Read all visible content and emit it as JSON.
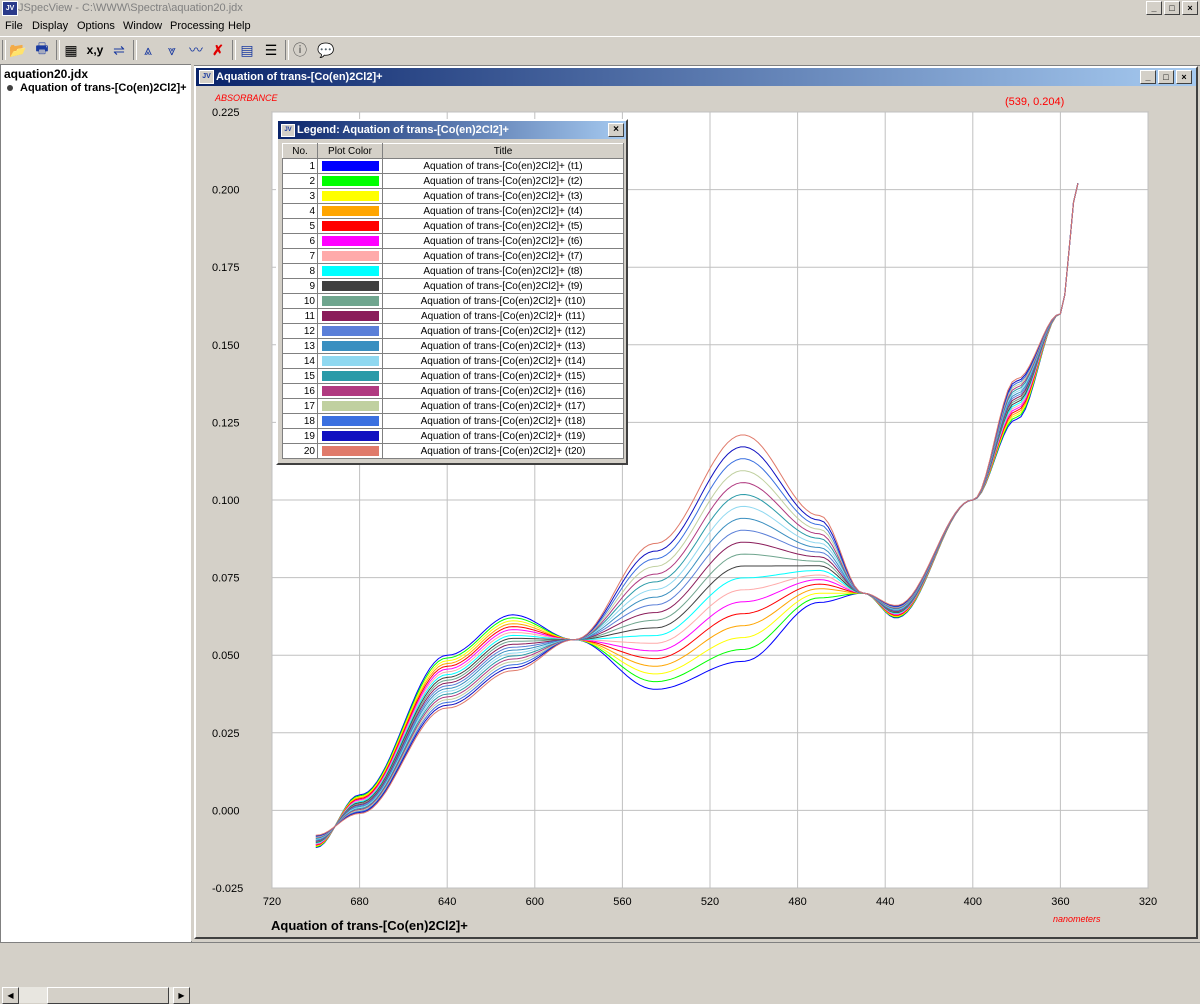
{
  "app": {
    "title": "JSpecView - C:\\WWW\\Spectra\\aquation20.jdx",
    "icon_label": "JV",
    "window_buttons": [
      "_",
      "□",
      "×"
    ]
  },
  "menu": [
    "File",
    "Display",
    "Options",
    "Window",
    "Processing",
    "Help"
  ],
  "toolbar": {
    "buttons": [
      {
        "name": "open-icon",
        "glyph": "📂"
      },
      {
        "name": "print-icon",
        "glyph": "🖶"
      },
      {
        "name": "grid-icon",
        "glyph": "▦"
      },
      {
        "name": "coordinates-button",
        "glyph": "x,y"
      },
      {
        "name": "reverse-plot-icon",
        "glyph": "⇌"
      },
      {
        "name": "overlay-spectra-icon",
        "glyph": "⩓"
      },
      {
        "name": "split-spectra-icon",
        "glyph": "⩔"
      },
      {
        "name": "overlay-key-icon",
        "glyph": "〰"
      },
      {
        "name": "close-spectrum-icon",
        "glyph": "✗"
      },
      {
        "name": "source-view-icon",
        "glyph": "▤"
      },
      {
        "name": "legend-list-icon",
        "glyph": "☰"
      },
      {
        "name": "about-icon",
        "glyph": "ⓘ"
      },
      {
        "name": "help-icon",
        "glyph": "💬"
      }
    ]
  },
  "tree": {
    "file": "aquation20.jdx",
    "item": "Aquation of trans-[Co(en)2Cl2]+"
  },
  "child_window": {
    "title": "Aquation of trans-[Co(en)2Cl2]+"
  },
  "plot": {
    "ylabel": "ABSORBANCE",
    "xlabel": "nanometers",
    "title": "Aquation of trans-[Co(en)2Cl2]+",
    "coord_readout": "(539, 0.204)",
    "y_ticks": [
      "0.225",
      "0.200",
      "0.175",
      "0.150",
      "0.125",
      "0.100",
      "0.075",
      "0.050",
      "0.025",
      "0.000",
      "-0.025"
    ],
    "x_ticks": [
      "720",
      "680",
      "640",
      "600",
      "560",
      "520",
      "480",
      "440",
      "400",
      "360",
      "320"
    ],
    "xlim": [
      720,
      320
    ],
    "ylim": [
      -0.025,
      0.225
    ]
  },
  "chart_data": {
    "type": "line",
    "x_range": [
      700,
      352
    ],
    "xlim": [
      720,
      320
    ],
    "ylim": [
      -0.025,
      0.225
    ],
    "grid": true,
    "xlabel": "nanometers",
    "ylabel": "ABSORBANCE",
    "series_t1": {
      "x": [
        700,
        680,
        640,
        610,
        582,
        545,
        505,
        470,
        450,
        435,
        400,
        380,
        360,
        352
      ],
      "y": [
        -0.012,
        0.005,
        0.05,
        0.063,
        0.055,
        0.039,
        0.048,
        0.067,
        0.07,
        0.062,
        0.1,
        0.126,
        0.16,
        0.202
      ]
    },
    "series_t20": {
      "x": [
        700,
        680,
        640,
        610,
        582,
        545,
        505,
        470,
        450,
        435,
        400,
        380,
        360,
        352
      ],
      "y": [
        -0.008,
        -0.001,
        0.033,
        0.045,
        0.055,
        0.086,
        0.121,
        0.095,
        0.07,
        0.066,
        0.1,
        0.139,
        0.16,
        0.202
      ]
    }
  },
  "legend": {
    "title": "Legend: Aquation of trans-[Co(en)2Cl2]+",
    "close_glyph": "×",
    "headers": [
      "No.",
      "Plot Color",
      "Title"
    ],
    "rows": [
      {
        "no": "1",
        "color": "#0000ff",
        "title": "Aquation of trans-[Co(en)2Cl2]+ (t1)"
      },
      {
        "no": "2",
        "color": "#00ff00",
        "title": "Aquation of trans-[Co(en)2Cl2]+ (t2)"
      },
      {
        "no": "3",
        "color": "#ffff00",
        "title": "Aquation of trans-[Co(en)2Cl2]+ (t3)"
      },
      {
        "no": "4",
        "color": "#ffa500",
        "title": "Aquation of trans-[Co(en)2Cl2]+ (t4)"
      },
      {
        "no": "5",
        "color": "#ff0000",
        "title": "Aquation of trans-[Co(en)2Cl2]+ (t5)"
      },
      {
        "no": "6",
        "color": "#ff00ff",
        "title": "Aquation of trans-[Co(en)2Cl2]+ (t6)"
      },
      {
        "no": "7",
        "color": "#ffaaaa",
        "title": "Aquation of trans-[Co(en)2Cl2]+ (t7)"
      },
      {
        "no": "8",
        "color": "#00ffff",
        "title": "Aquation of trans-[Co(en)2Cl2]+ (t8)"
      },
      {
        "no": "9",
        "color": "#404040",
        "title": "Aquation of trans-[Co(en)2Cl2]+ (t9)"
      },
      {
        "no": "10",
        "color": "#6fa58e",
        "title": "Aquation of trans-[Co(en)2Cl2]+ (t10)"
      },
      {
        "no": "11",
        "color": "#8a1c5a",
        "title": "Aquation of trans-[Co(en)2Cl2]+ (t11)"
      },
      {
        "no": "12",
        "color": "#5a7fd8",
        "title": "Aquation of trans-[Co(en)2Cl2]+ (t12)"
      },
      {
        "no": "13",
        "color": "#3a8fc0",
        "title": "Aquation of trans-[Co(en)2Cl2]+ (t13)"
      },
      {
        "no": "14",
        "color": "#8fd8f0",
        "title": "Aquation of trans-[Co(en)2Cl2]+ (t14)"
      },
      {
        "no": "15",
        "color": "#2a9aa8",
        "title": "Aquation of trans-[Co(en)2Cl2]+ (t15)"
      },
      {
        "no": "16",
        "color": "#b03a80",
        "title": "Aquation of trans-[Co(en)2Cl2]+ (t16)"
      },
      {
        "no": "17",
        "color": "#c0d0a0",
        "title": "Aquation of trans-[Co(en)2Cl2]+ (t17)"
      },
      {
        "no": "18",
        "color": "#3a70e0",
        "title": "Aquation of trans-[Co(en)2Cl2]+ (t18)"
      },
      {
        "no": "19",
        "color": "#1010c0",
        "title": "Aquation of trans-[Co(en)2Cl2]+ (t19)"
      },
      {
        "no": "20",
        "color": "#e07a6a",
        "title": "Aquation of trans-[Co(en)2Cl2]+ (t20)"
      }
    ]
  },
  "colors": {
    "readout": "#ff0000",
    "axis_label": "#ff0000"
  }
}
